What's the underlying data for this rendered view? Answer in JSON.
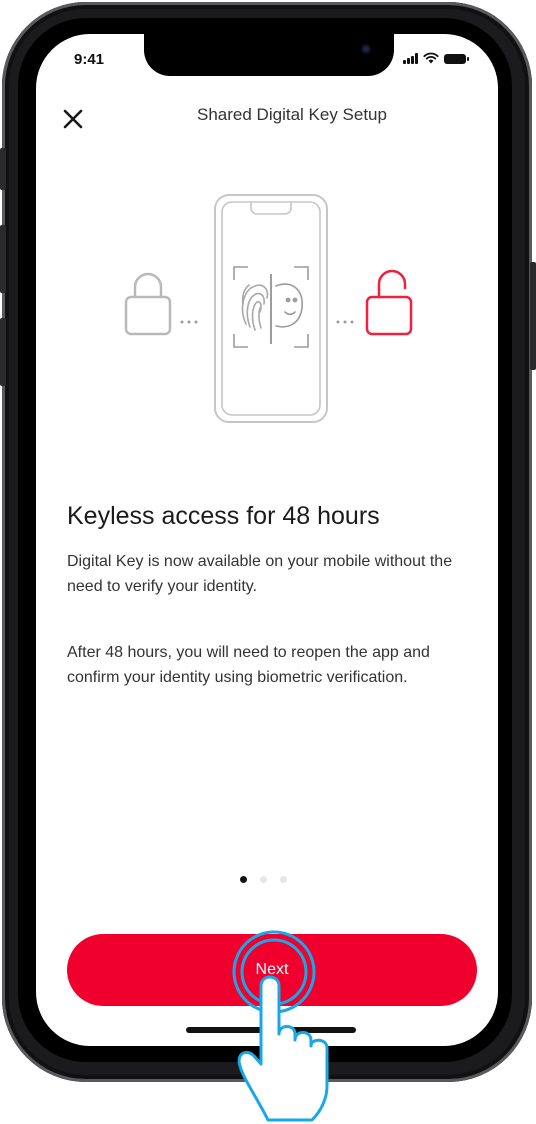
{
  "status_bar": {
    "time": "9:41"
  },
  "nav": {
    "title": "Shared Digital Key Setup",
    "close_icon": "close-icon"
  },
  "illustration": {
    "icons": [
      "locked-padlock-icon",
      "phone-outline-icon",
      "fingerprint-icon",
      "face-id-icon",
      "unlocked-padlock-icon"
    ],
    "colors": {
      "locked": "#b9b9b9",
      "unlocked": "#f0213e",
      "phone": "#c6c6c6"
    }
  },
  "content": {
    "heading": "Keyless access for 48 hours",
    "paragraph_1": "Digital Key is now available on your mobile without the need to verify your identity.",
    "paragraph_2": "After 48 hours, you will need to reopen the app and confirm your identity using biometric verification."
  },
  "pager": {
    "count": 3,
    "active_index": 0
  },
  "actions": {
    "next_label": "Next"
  },
  "colors": {
    "accent": "#f0002d",
    "tap_indicator": "#1aa7e8",
    "text": "#1a1a1a"
  }
}
